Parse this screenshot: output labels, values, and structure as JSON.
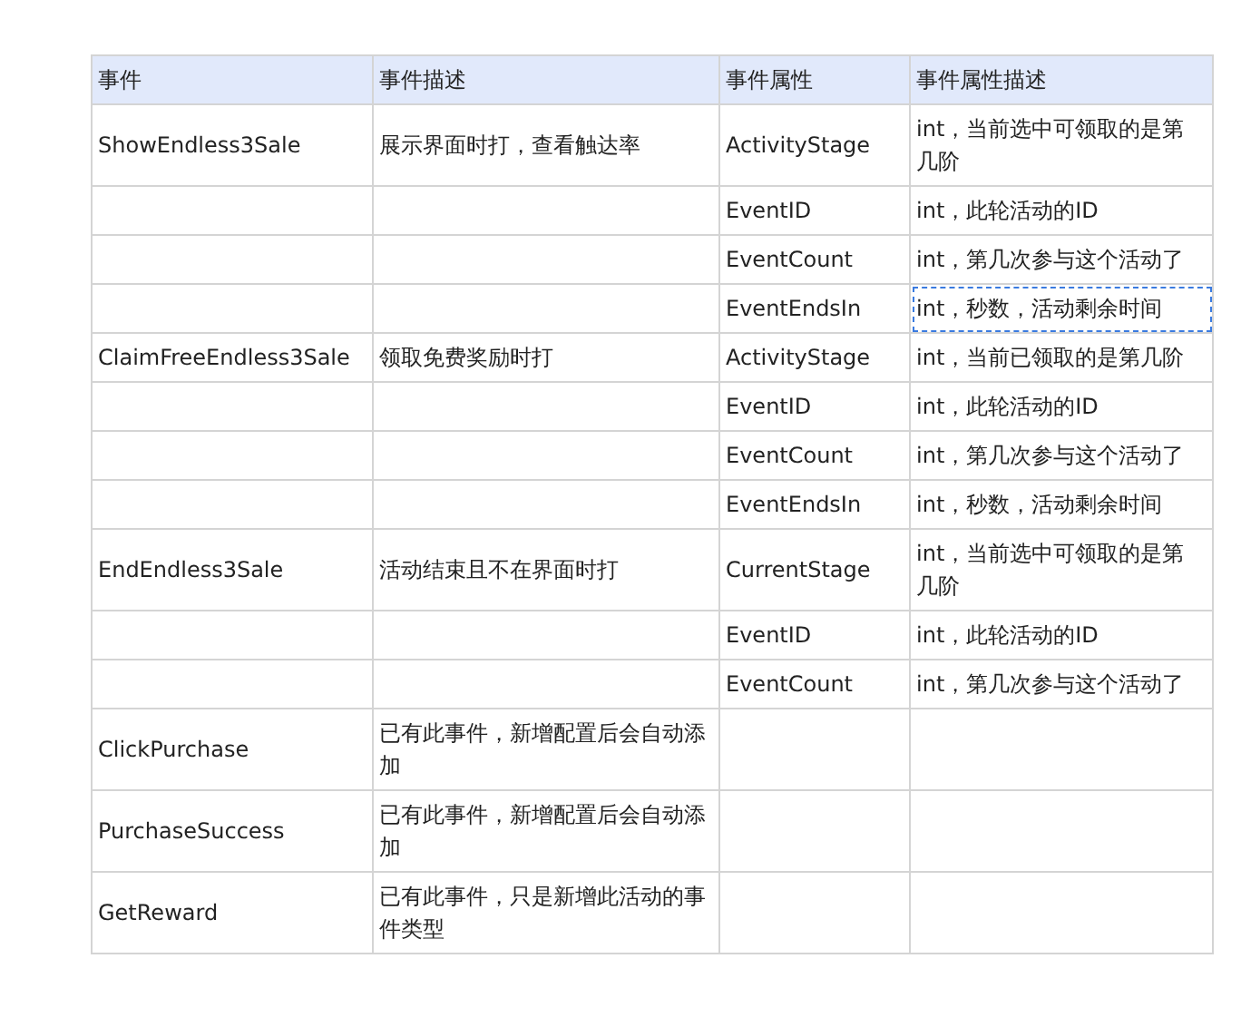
{
  "table": {
    "columns": [
      "事件",
      "事件描述",
      "事件属性",
      "事件属性描述"
    ],
    "rows": [
      {
        "event": "ShowEndless3Sale",
        "event_desc": "展示界面时打，查看触达率",
        "attribute": "ActivityStage",
        "attribute_desc": "int，当前选中可领取的是第几阶",
        "selected": false
      },
      {
        "attribute": "EventID",
        "attribute_desc": "int，此轮活动的ID",
        "selected": false
      },
      {
        "attribute": "EventCount",
        "attribute_desc": "int，第几次参与这个活动了",
        "selected": false
      },
      {
        "attribute": "EventEndsIn",
        "attribute_desc": "int，秒数，活动剩余时间",
        "selected": true
      },
      {
        "event": "ClaimFreeEndless3Sale",
        "event_desc": "领取免费奖励时打",
        "attribute": "ActivityStage",
        "attribute_desc": "int，当前已领取的是第几阶",
        "selected": false
      },
      {
        "attribute": "EventID",
        "attribute_desc": "int，此轮活动的ID",
        "selected": false
      },
      {
        "attribute": "EventCount",
        "attribute_desc": "int，第几次参与这个活动了",
        "selected": false
      },
      {
        "attribute": "EventEndsIn",
        "attribute_desc": "int，秒数，活动剩余时间",
        "selected": false
      },
      {
        "event": "EndEndless3Sale",
        "event_desc": "活动结束且不在界面时打",
        "attribute": "CurrentStage",
        "attribute_desc": "int，当前选中可领取的是第几阶",
        "selected": false
      },
      {
        "attribute": "EventID",
        "attribute_desc": "int，此轮活动的ID",
        "selected": false
      },
      {
        "attribute": "EventCount",
        "attribute_desc": "int，第几次参与这个活动了",
        "selected": false
      },
      {
        "event": "ClickPurchase",
        "event_desc": "已有此事件，新增配置后会自动添加",
        "selected": false
      },
      {
        "event": "PurchaseSuccess",
        "event_desc": "已有此事件，新增配置后会自动添加",
        "selected": false
      },
      {
        "event": "GetReward",
        "event_desc": "已有此事件，只是新增此活动的事件类型",
        "selected": false
      }
    ]
  }
}
